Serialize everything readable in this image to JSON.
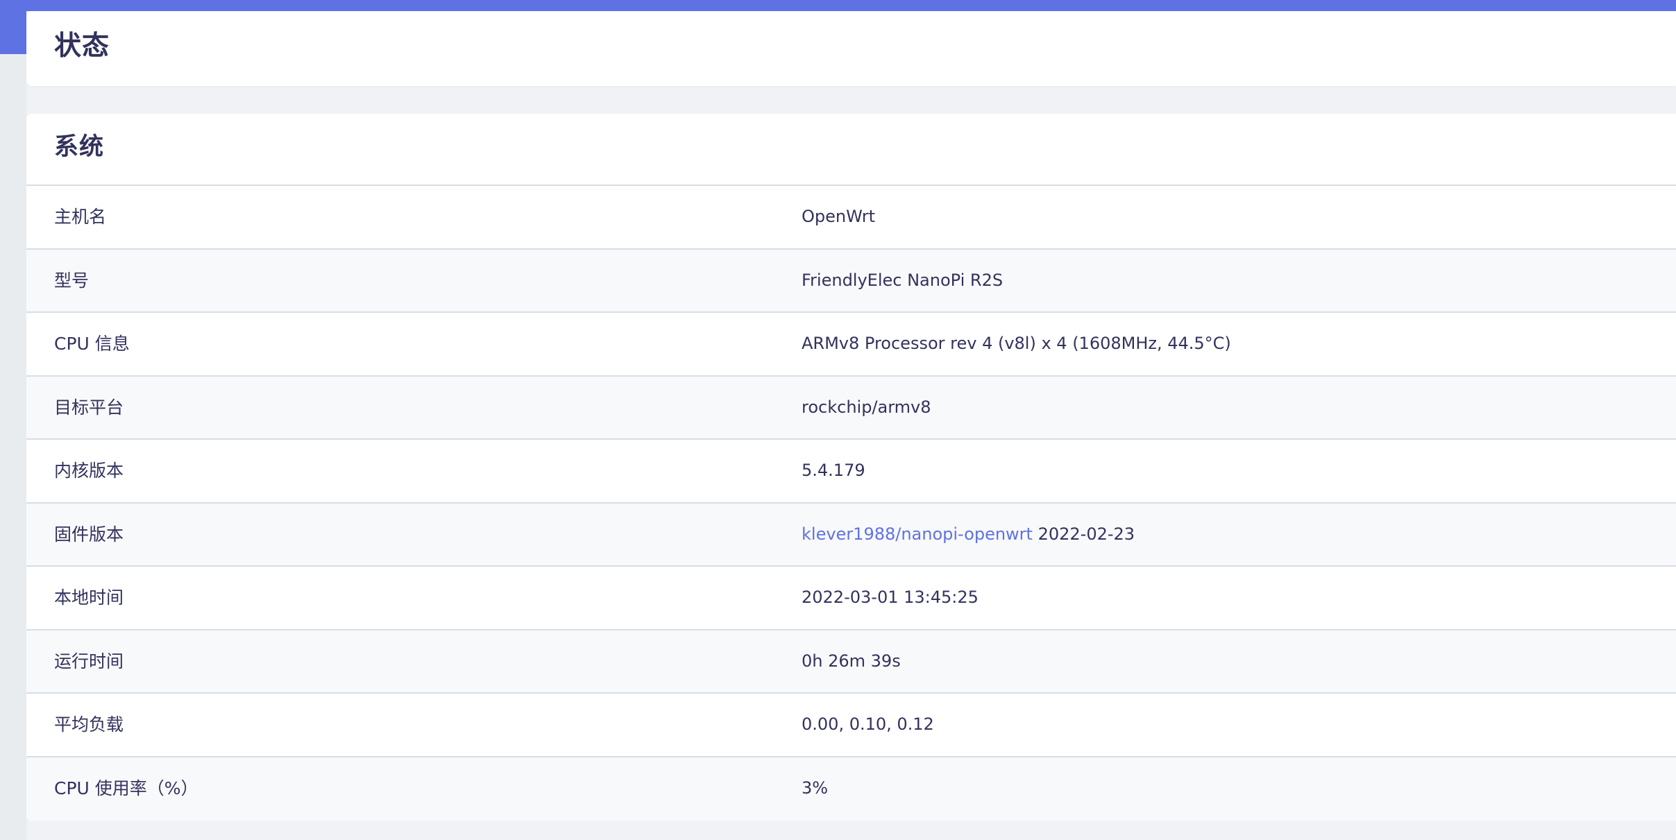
{
  "page": {
    "title": "状态"
  },
  "system": {
    "title": "系统",
    "rows": [
      {
        "label": "主机名",
        "value": "OpenWrt"
      },
      {
        "label": "型号",
        "value": "FriendlyElec NanoPi R2S"
      },
      {
        "label": "CPU 信息",
        "value": "ARMv8 Processor rev 4 (v8l) x 4 (1608MHz, 44.5°C)"
      },
      {
        "label": "目标平台",
        "value": "rockchip/armv8"
      },
      {
        "label": "内核版本",
        "value": "5.4.179"
      },
      {
        "label": "固件版本",
        "link": "klever1988/nanopi-openwrt",
        "value": "2022-02-23"
      },
      {
        "label": "本地时间",
        "value": "2022-03-01 13:45:25"
      },
      {
        "label": "运行时间",
        "value": "0h 26m 39s"
      },
      {
        "label": "平均负载",
        "value": "0.00, 0.10, 0.12"
      },
      {
        "label": "CPU 使用率（%）",
        "value": "3%"
      }
    ]
  },
  "colors": {
    "accent": "#5e72e4",
    "text": "#32325d",
    "background": "#f0f2f5",
    "row_alt": "#f8f9fa",
    "border": "#d8dde5"
  }
}
